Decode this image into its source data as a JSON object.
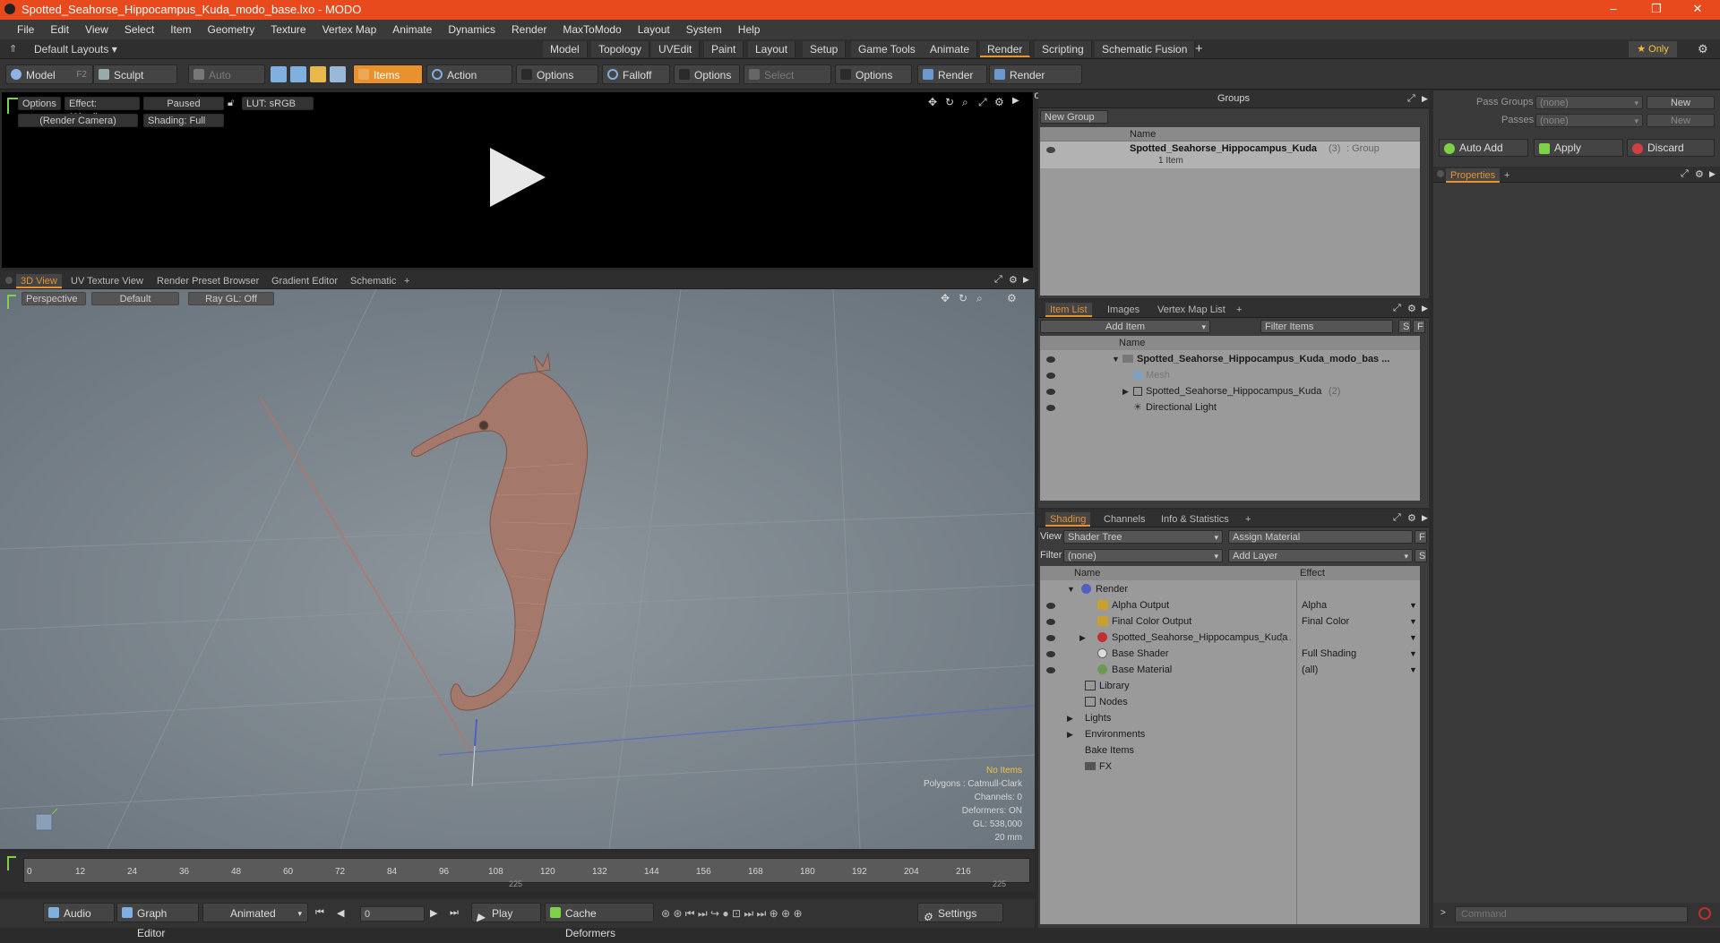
{
  "window": {
    "title": "Spotted_Seahorse_Hippocampus_Kuda_modo_base.lxo - MODO",
    "minimize": "–",
    "maximize": "❐",
    "close": "✕"
  },
  "menu": [
    "File",
    "Edit",
    "View",
    "Select",
    "Item",
    "Geometry",
    "Texture",
    "Vertex Map",
    "Animate",
    "Dynamics",
    "Render",
    "MaxToModo",
    "Layout",
    "System",
    "Help"
  ],
  "layoutbar": {
    "layouts": "Default Layouts ▾",
    "tabs": [
      "Model",
      "Topology",
      "UVEdit",
      "Paint",
      "Layout",
      "Setup",
      "Game Tools",
      "Animate",
      "Render",
      "Scripting",
      "Schematic Fusion"
    ],
    "active": "Render",
    "add": "+",
    "only": "★ Only"
  },
  "toolbar": {
    "model": "Model",
    "model_key": "F2",
    "sculpt": "Sculpt",
    "auto_select": "Auto Select",
    "items": "Items",
    "action_center": "Action Center",
    "options1": "Options",
    "falloff": "Falloff",
    "options2": "Options",
    "select_through": "Select Through",
    "options3": "Options",
    "render": "Render",
    "render_key": "F9",
    "render_window": "Render Window"
  },
  "render_view": {
    "options": "Options",
    "effect": "Effect: (Shadi...",
    "paused": "Paused",
    "lut": "LUT: sRGB",
    "camera": "(Render Camera)",
    "shading": "Shading: Full"
  },
  "viewport_tabs": {
    "tabs": [
      "3D View",
      "UV Texture View",
      "Render Preset Browser",
      "Gradient Editor",
      "Schematic"
    ],
    "add": "+"
  },
  "viewport": {
    "perspective": "Perspective",
    "default": "Default",
    "raygl": "Ray GL: Off",
    "info_title": "No Items",
    "info": [
      "Polygons : Catmull-Clark",
      "Channels: 0",
      "Deformers: ON",
      "GL: 538,000",
      "20 mm"
    ]
  },
  "timeline": {
    "ticks": [
      "0",
      "12",
      "24",
      "36",
      "48",
      "60",
      "72",
      "84",
      "96",
      "108",
      "120",
      "132",
      "144",
      "156",
      "168",
      "180",
      "192",
      "204",
      "216"
    ],
    "mid": "225",
    "end": "225"
  },
  "bottombar": {
    "audio": "Audio",
    "graph_editor": "Graph Editor",
    "animated": "Animated",
    "frame": "0",
    "play": "Play",
    "cache": "Cache Deformers",
    "settings": "Settings"
  },
  "groups": {
    "title": "Groups",
    "new_group": "New Group",
    "col_name": "Name",
    "item_name": "Spotted_Seahorse_Hippocampus_Kuda",
    "item_count": "(3)",
    "item_type": ": Group",
    "item_sub": "1 Item"
  },
  "itemlist": {
    "tabs": [
      "Item List",
      "Images",
      "Vertex Map List"
    ],
    "add": "+",
    "add_item": "Add Item",
    "filter": "Filter Items",
    "s": "S",
    "f": "F",
    "col_name": "Name",
    "rows": [
      {
        "label": "Spotted_Seahorse_Hippocampus_Kuda_modo_bas ...",
        "indent": 0
      },
      {
        "label": "Mesh",
        "indent": 1
      },
      {
        "label": "Spotted_Seahorse_Hippocampus_Kuda",
        "extra": "(2)",
        "indent": 1
      },
      {
        "label": "Directional Light",
        "indent": 1
      }
    ]
  },
  "shading": {
    "tabs": [
      "Shading",
      "Channels",
      "Info & Statistics"
    ],
    "add": "+",
    "view_label": "View",
    "view_value": "Shader Tree",
    "assign": "Assign Material",
    "f": "F",
    "filter_label": "Filter",
    "filter_value": "(none)",
    "add_layer": "Add Layer",
    "s": "S",
    "col_name": "Name",
    "col_effect": "Effect",
    "rows": [
      {
        "label": "Render",
        "effect": "",
        "indent": 0
      },
      {
        "label": "Alpha Output",
        "effect": "Alpha",
        "indent": 1
      },
      {
        "label": "Final Color Output",
        "effect": "Final Color",
        "indent": 1
      },
      {
        "label": "Spotted_Seahorse_Hippocampus_Kuda",
        "extra": "(...",
        "effect": "",
        "indent": 1
      },
      {
        "label": "Base Shader",
        "effect": "Full Shading",
        "indent": 1
      },
      {
        "label": "Base Material",
        "effect": "(all)",
        "indent": 1
      },
      {
        "label": "Library",
        "effect": "",
        "indent": 1
      },
      {
        "label": "Nodes",
        "effect": "",
        "indent": 1
      },
      {
        "label": "Lights",
        "effect": "",
        "indent": 0
      },
      {
        "label": "Environments",
        "effect": "",
        "indent": 0
      },
      {
        "label": "Bake Items",
        "effect": "",
        "indent": 0
      },
      {
        "label": "FX",
        "effect": "",
        "indent": 0
      }
    ]
  },
  "passes": {
    "pass_groups": "Pass Groups",
    "pass_groups_val": "(none)",
    "new1": "New",
    "passes": "Passes",
    "passes_val": "(none)",
    "new2": "New",
    "auto_add": "Auto Add",
    "apply": "Apply",
    "discard": "Discard",
    "properties": "Properties",
    "add": "+"
  },
  "command": {
    "placeholder": "Command"
  }
}
